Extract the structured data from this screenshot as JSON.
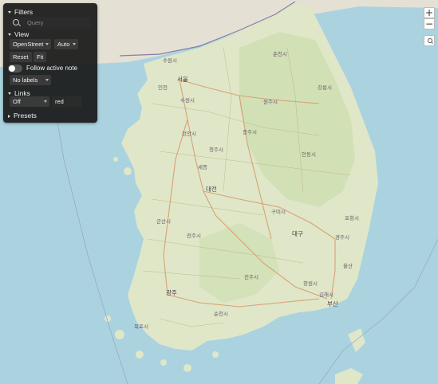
{
  "map": {
    "land_color": "#dfe7c8",
    "water_color": "#aad3df",
    "labels": [
      {
        "name": "city-seoul",
        "text": "서울"
      },
      {
        "name": "city-incheon",
        "text": "인천"
      },
      {
        "name": "city-suwon",
        "text": "수원시"
      },
      {
        "name": "city-paju",
        "text": "파주시"
      },
      {
        "name": "city-chuncheon",
        "text": "춘천시"
      },
      {
        "name": "city-wonju",
        "text": "원주시"
      },
      {
        "name": "city-gangneung",
        "text": "강릉시"
      },
      {
        "name": "city-cheongju",
        "text": "청주시"
      },
      {
        "name": "city-cheonan",
        "text": "천안시"
      },
      {
        "name": "city-daejeon",
        "text": "대전"
      },
      {
        "name": "city-daegu",
        "text": "대구"
      },
      {
        "name": "city-gumi",
        "text": "구미시"
      },
      {
        "name": "city-pohang",
        "text": "포항시"
      },
      {
        "name": "city-jeonju",
        "text": "전주시"
      },
      {
        "name": "city-gunsan",
        "text": "군산시"
      },
      {
        "name": "city-gwangju",
        "text": "광주"
      },
      {
        "name": "city-ulsan",
        "text": "울산"
      },
      {
        "name": "city-busan",
        "text": "부산"
      },
      {
        "name": "city-changwon",
        "text": "창원시"
      },
      {
        "name": "city-jinju",
        "text": "진주시"
      },
      {
        "name": "city-mokpo",
        "text": "목포시"
      },
      {
        "name": "city-suncheon",
        "text": "순천시"
      },
      {
        "name": "city-gyeongju",
        "text": "경주시"
      },
      {
        "name": "city-andong",
        "text": "안동시"
      },
      {
        "name": "city-chungju",
        "text": "충주시"
      },
      {
        "name": "city-sejong",
        "text": "세종"
      },
      {
        "name": "city-gimhae",
        "text": "김해시"
      }
    ]
  },
  "panel": {
    "filters": {
      "title": "Filters",
      "query_placeholder": "Query"
    },
    "view": {
      "title": "View",
      "layer": "OpenStreet",
      "mode": "Auto",
      "reset": "Reset",
      "fit": "Fit",
      "follow_label": "Follow active note",
      "labels_option": "No labels"
    },
    "links": {
      "title": "Links",
      "state": "Off",
      "color": "red"
    },
    "presets": {
      "title": "Presets"
    }
  },
  "controls": {
    "zoom_in": "+",
    "zoom_out": "−"
  }
}
